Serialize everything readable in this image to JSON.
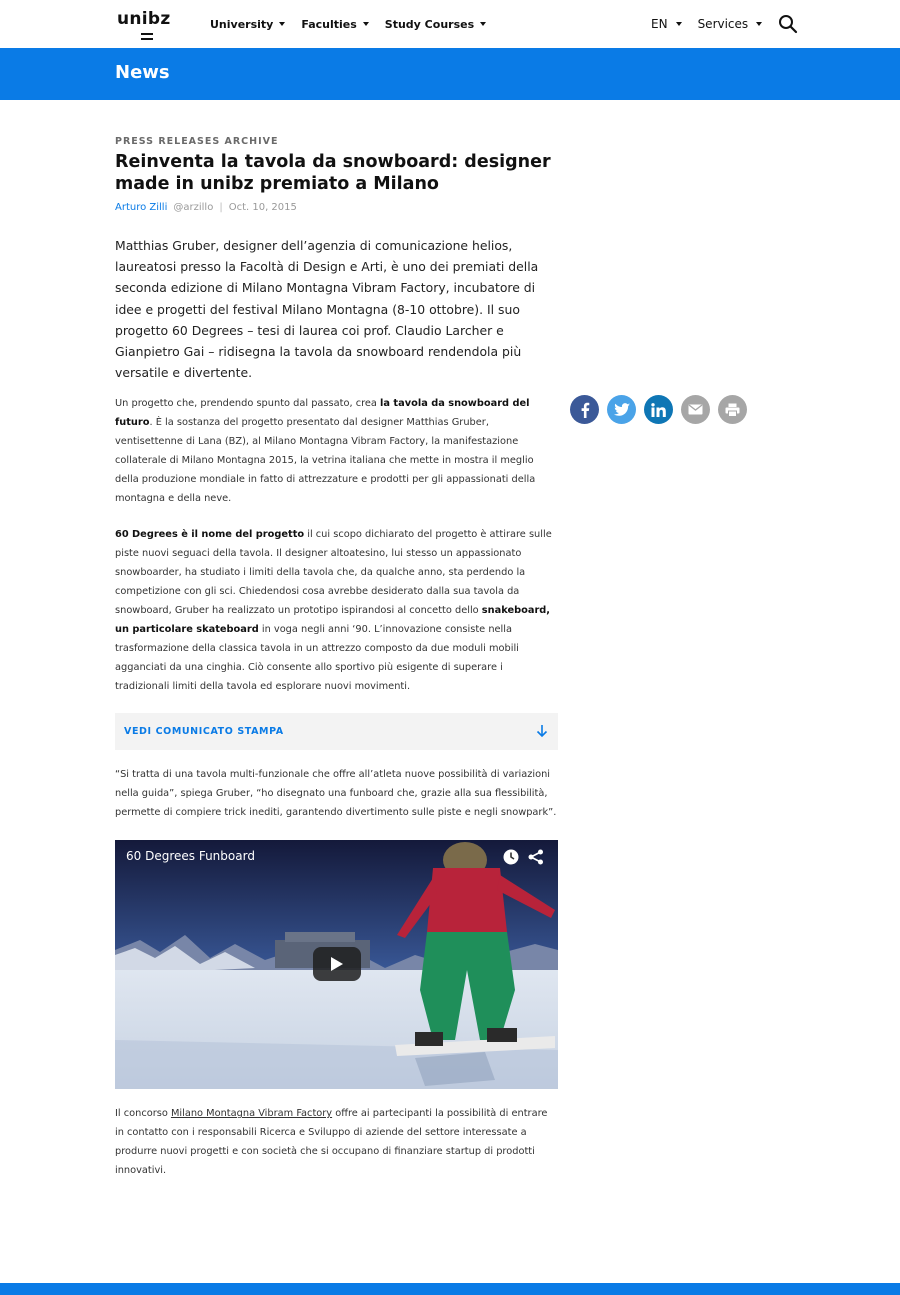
{
  "logo": {
    "text": "unibz"
  },
  "nav": {
    "items": [
      {
        "label": "University"
      },
      {
        "label": "Faculties"
      },
      {
        "label": "Study Courses"
      }
    ],
    "language": "EN",
    "services": "Services"
  },
  "banner": {
    "title": "News"
  },
  "article": {
    "eyebrow": "PRESS RELEASES ARCHIVE",
    "title": "Reinventa la tavola da snowboard: designer made in unibz premiato a Milano",
    "author": "Arturo Zilli",
    "handle": "@arzillo",
    "separator": "|",
    "date": "Oct. 10, 2015",
    "lead": "Matthias Gruber, designer dell’agenzia di comunicazione helios, laureatosi presso la Facoltà di Design e Arti, è uno dei premiati della seconda edizione di Milano Montagna Vibram Factory, incubatore di idee e progetti del festival Milano Montagna (8-10 ottobre). Il suo progetto 60 Degrees – tesi di laurea coi prof. Claudio Larcher e Gianpietro Gai – ridisegna la tavola da snowboard rendendola più versatile e divertente.",
    "p1": {
      "a": "Un progetto che, prendendo spunto dal passato, crea ",
      "bold": "la tavola da snowboard del futuro",
      "b": ". È la sostanza del progetto presentato dal designer Matthias Gruber, ventisettenne di Lana (BZ), al Milano Montagna Vibram Factory, la manifestazione collaterale di Milano Montagna 2015, la vetrina italiana che mette in mostra il meglio della produzione mondiale in fatto di attrezzature e prodotti per gli appassionati della montagna e della neve."
    },
    "p2": {
      "bold1": "60 Degrees è il nome del progetto",
      "a": " il cui scopo dichiarato del progetto è attirare sulle piste nuovi seguaci della tavola. Il designer altoatesino, lui stesso un appassionato snowboarder, ha studiato i limiti della tavola che, da qualche anno, sta perdendo la competizione con gli sci. Chiedendosi cosa avrebbe desiderato dalla sua tavola da snowboard, Gruber ha realizzato un prototipo ispirandosi al concetto dello ",
      "bold2": "snakeboard, un particolare skateboard",
      "b": " in voga negli anni ‘90. L’innovazione consiste nella trasformazione della classica tavola in un attrezzo composto da due moduli mobili agganciati da una cinghia. Ciò consente allo sportivo più esigente di superare i tradizionali limiti della tavola ed esplorare nuovi movimenti."
    },
    "accordion_label": "VEDI COMUNICATO STAMPA",
    "quote": "“Si tratta di una tavola multi-funzionale che offre all’atleta nuove possibilità di variazioni nella guida”, spiega Gruber, “ho disegnato una funboard che, grazie alla sua flessibilità, permette di compiere trick inediti, garantendo divertimento sulle piste e negli snowpark”.",
    "video_title": "60 Degrees Funboard",
    "p3": {
      "a": "Il concorso ",
      "link": "Milano Montagna Vibram Factory",
      "b": " offre ai partecipanti la possibilità di entrare in contatto con i responsabili Ricerca e Sviluppo di aziende del settore interessate a produrre nuovi progetti e con società che si occupano di finanziare startup di prodotti innovativi."
    }
  },
  "social": [
    {
      "icon": "facebook-icon",
      "color": "#3b5998"
    },
    {
      "icon": "twitter-icon",
      "color": "#4aa3e8"
    },
    {
      "icon": "linkedin-icon",
      "color": "#0e76b5"
    },
    {
      "icon": "email-icon",
      "color": "#a6a6a6"
    },
    {
      "icon": "print-icon",
      "color": "#a6a6a6"
    }
  ],
  "colors": {
    "accent": "#0a7be6"
  }
}
